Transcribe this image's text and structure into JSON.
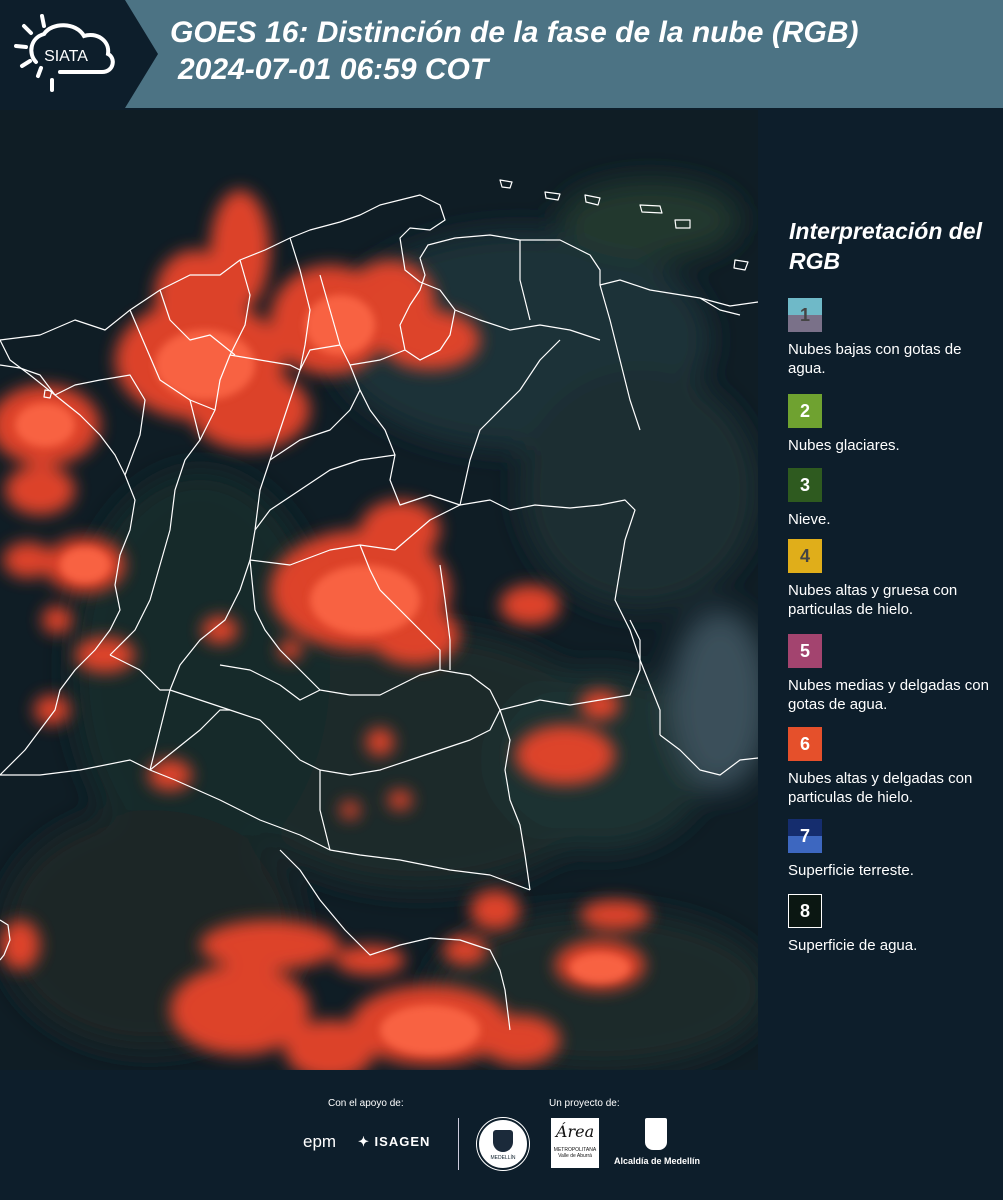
{
  "header": {
    "logo_text": "SIATA",
    "title_line1": "GOES 16: Distinción de la fase de la nube (RGB)",
    "title_line2": "2024-07-01 06:59 COT"
  },
  "legend": {
    "title": "Interpretación del RGB",
    "items": [
      {
        "number": "1",
        "label": "Nubes bajas con gotas de agua.",
        "color_top": "#6fb9c8",
        "color_bottom": "#7a7189",
        "number_color": "#444444"
      },
      {
        "number": "2",
        "label": "Nubes glaciares.",
        "color_top": "#6fa230",
        "color_bottom": "#6fa230",
        "number_color": "#ffffff"
      },
      {
        "number": "3",
        "label": "Nieve.",
        "color_top": "#2e5a1f",
        "color_bottom": "#2e5a1f",
        "number_color": "#ffffff"
      },
      {
        "number": "4",
        "label": "Nubes altas y gruesa con particulas de hielo.",
        "color_top": "#e0ae1a",
        "color_bottom": "#e0ae1a",
        "number_color": "#444444"
      },
      {
        "number": "5",
        "label": "Nubes medias y delgadas con gotas de agua.",
        "color_top": "#a3446f",
        "color_bottom": "#a3446f",
        "number_color": "#ffffff"
      },
      {
        "number": "6",
        "label": "Nubes altas y delgadas con particulas de hielo.",
        "color_top": "#e5502b",
        "color_bottom": "#e5502b",
        "number_color": "#ffffff"
      },
      {
        "number": "7",
        "label": "Superficie terreste.",
        "color_top": "#152d6e",
        "color_bottom": "#3d67c0",
        "number_color": "#ffffff"
      },
      {
        "number": "8",
        "label": "Superficie de agua.",
        "color_top": "#0b1712",
        "color_bottom": "#0b1712",
        "number_color": "#ffffff"
      }
    ]
  },
  "footer": {
    "support_label": "Con el apoyo de:",
    "project_label": "Un proyecto de:",
    "sponsor_epm": "epm",
    "sponsor_isagen": "ISAGEN",
    "partner_area_main": "Área",
    "partner_area_sub1": "METROPOLITANA",
    "partner_area_sub2": "Valle de Aburrá",
    "partner_alcaldia": "Alcaldía de Medellín",
    "seal_text": "MEDELLÍN"
  }
}
